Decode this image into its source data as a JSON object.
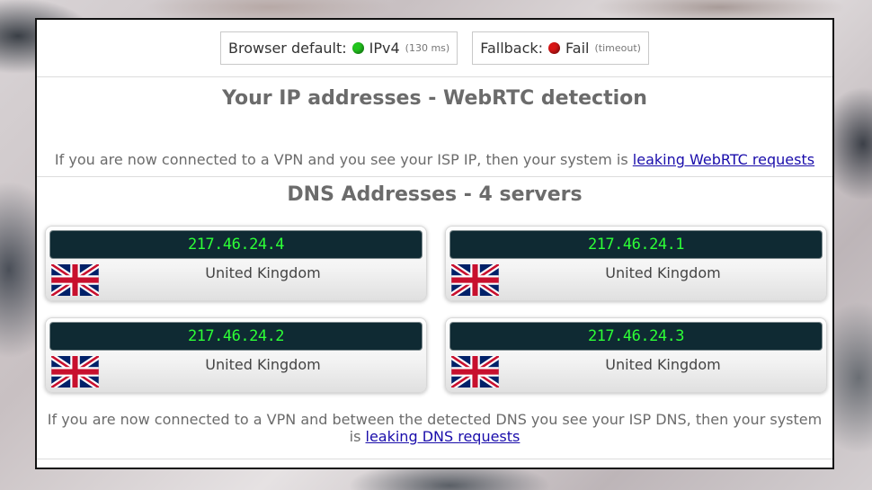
{
  "status": {
    "browser_default_label": "Browser default:",
    "browser_default_value": "IPv4",
    "browser_default_detail": "(130 ms)",
    "fallback_label": "Fallback:",
    "fallback_value": "Fail",
    "fallback_detail": "(timeout)",
    "colors": {
      "ok": "#22c51e",
      "fail": "#d81616"
    }
  },
  "webrtc": {
    "heading": "Your IP addresses - WebRTC detection",
    "note_text": "If you are now connected to a VPN and you see your ISP IP, then your system is",
    "note_link": "leaking WebRTC requests"
  },
  "dns": {
    "heading": "DNS Addresses - 4 servers",
    "servers": [
      {
        "ip": "217.46.24.4",
        "country": "United Kingdom",
        "flag_icon": "uk-flag-icon"
      },
      {
        "ip": "217.46.24.1",
        "country": "United Kingdom",
        "flag_icon": "uk-flag-icon"
      },
      {
        "ip": "217.46.24.2",
        "country": "United Kingdom",
        "flag_icon": "uk-flag-icon"
      },
      {
        "ip": "217.46.24.3",
        "country": "United Kingdom",
        "flag_icon": "uk-flag-icon"
      }
    ],
    "note_text": "If you are now connected to a VPN and between the detected DNS you see your ISP DNS, then your system is",
    "note_link": "leaking DNS requests"
  }
}
